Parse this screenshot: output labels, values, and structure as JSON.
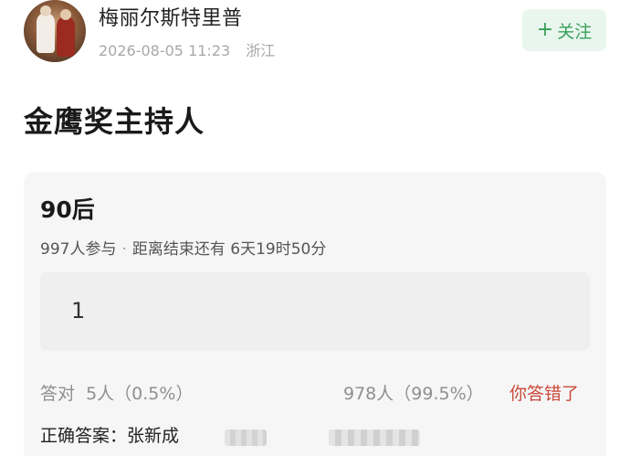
{
  "header": {
    "username": "梅丽尔斯特里普",
    "date": "2026-08-05 11:23",
    "location": "浙江",
    "follow_label": "关注"
  },
  "post": {
    "title": "金鹰奖主持人"
  },
  "poll": {
    "question": "90后",
    "participants": "997人参与",
    "deadline": "距离结束还有 6天19时50分",
    "option_text": "1",
    "correct_stat": "答对  5人（0.5%）",
    "wrong_stat": "978人（99.5%）",
    "result_label": "你答错了",
    "answer": "正确答案：张新成"
  },
  "colors": {
    "follow_bg": "#e9f6ee",
    "follow_text": "#3aa05c",
    "wrong_text": "#c94a3a",
    "card_bg": "#f6f6f6"
  }
}
